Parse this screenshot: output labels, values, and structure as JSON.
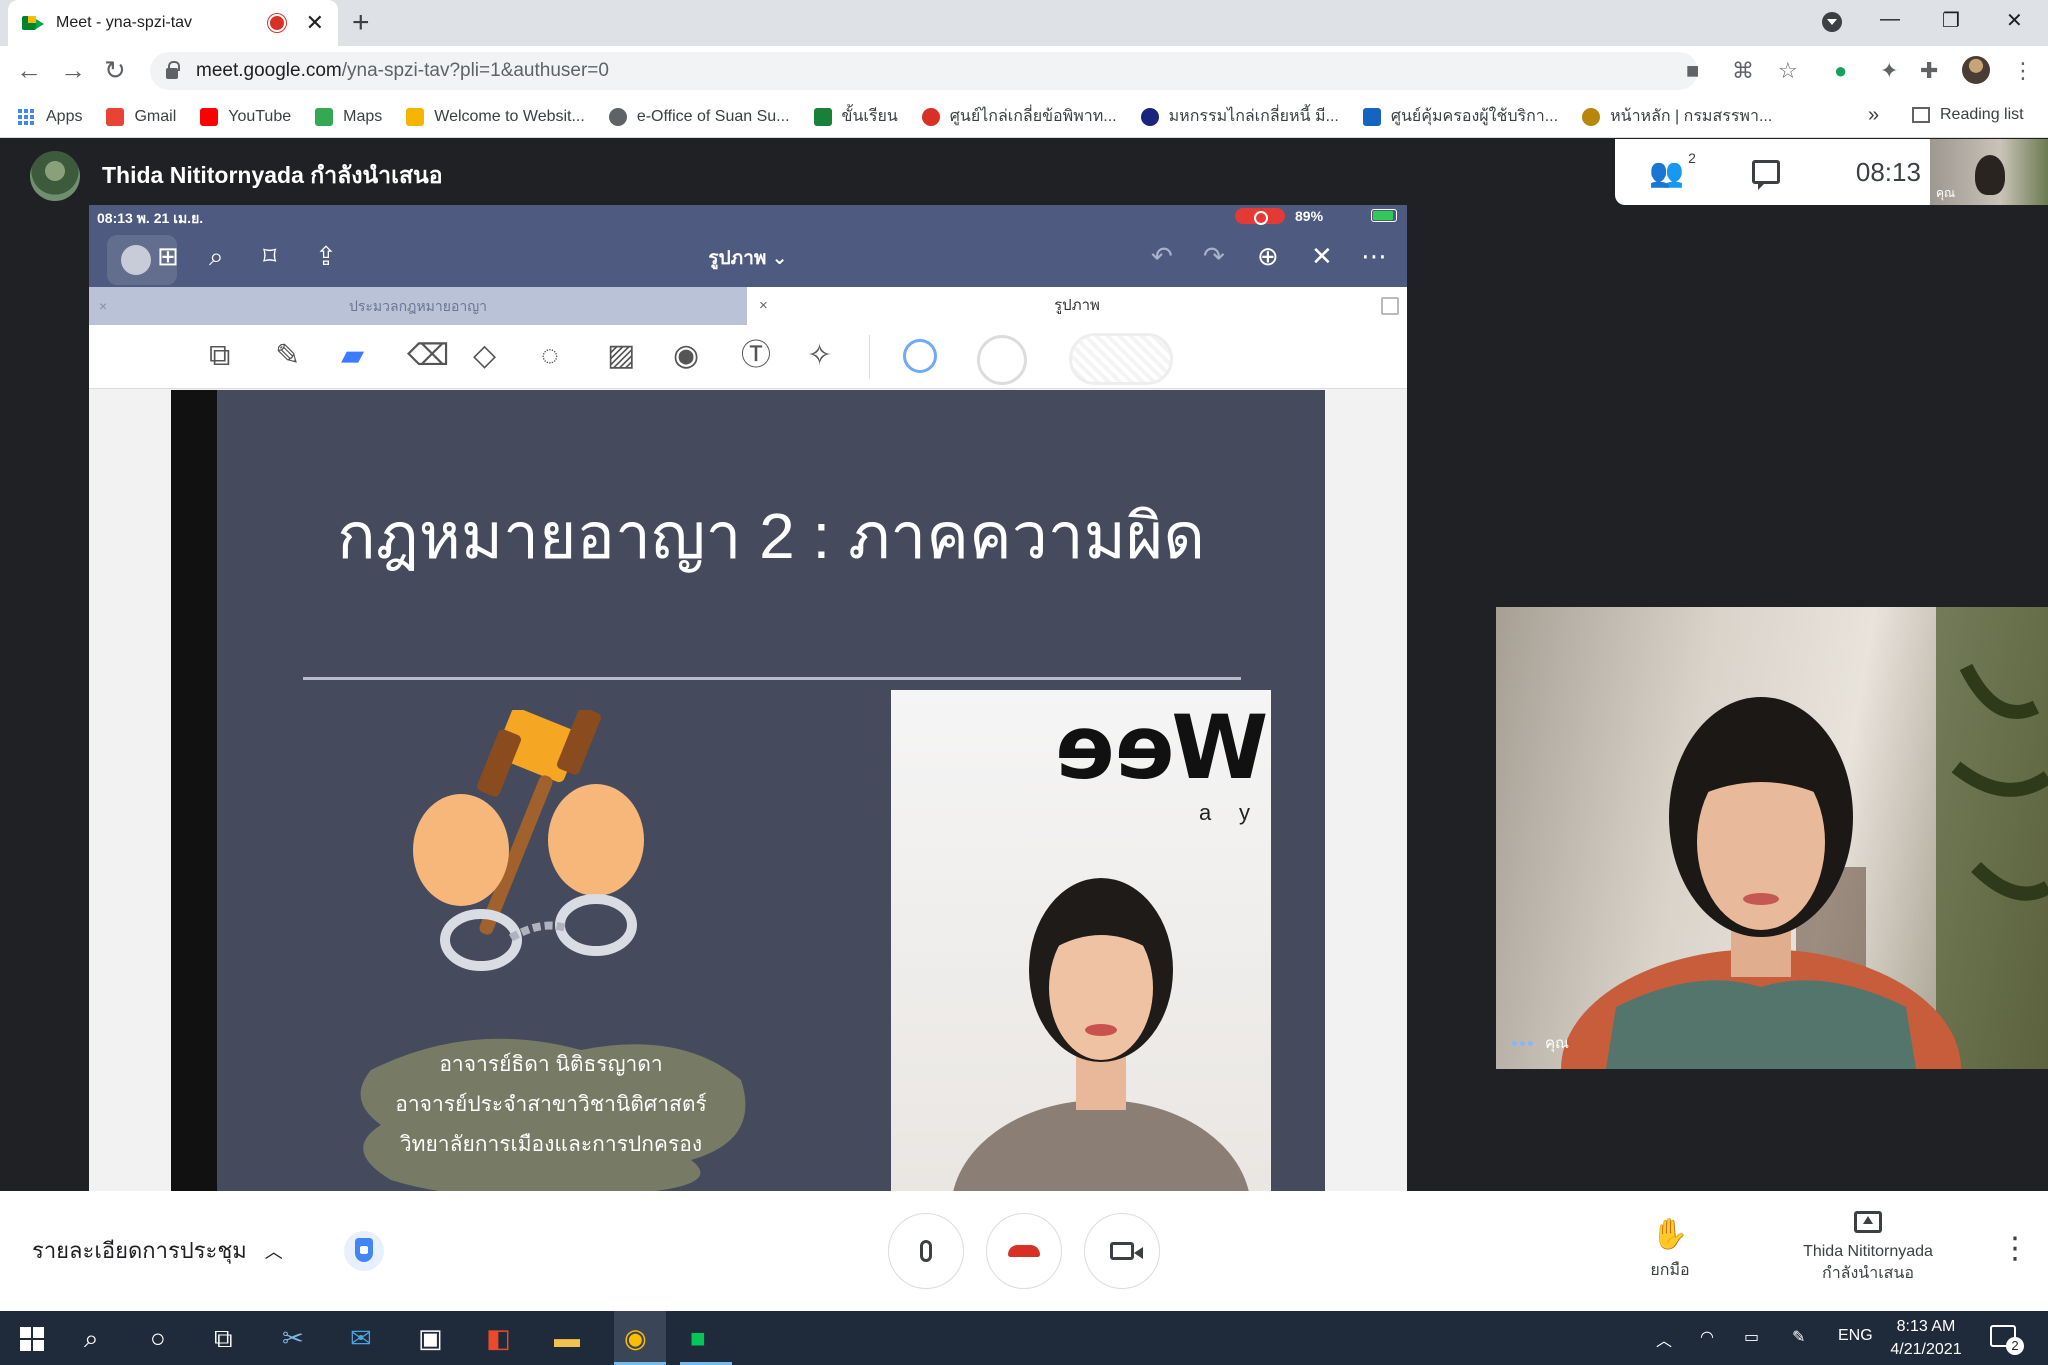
{
  "browser": {
    "tab_title": "Meet - yna-spzi-tav",
    "tab_close": "✕",
    "new_tab": "+",
    "url_host": "meet.google.com",
    "url_path": "/yna-spzi-tav?pli=1&authuser=0",
    "window_controls": [
      "—",
      "❐",
      "✕"
    ],
    "nav": [
      "←",
      "→",
      "↻"
    ],
    "bookmarks": [
      {
        "label": "Apps",
        "icon": "apps-grid-icon",
        "color": "#4285f4"
      },
      {
        "label": "Gmail",
        "icon": "gmail-icon",
        "color": "#ea4335"
      },
      {
        "label": "YouTube",
        "icon": "youtube-icon",
        "color": "#ff0000"
      },
      {
        "label": "Maps",
        "icon": "maps-icon",
        "color": "#34a853"
      },
      {
        "label": "Welcome to Websit...",
        "icon": "website-icon",
        "color": "#f4b400"
      },
      {
        "label": "e-Office of Suan Su...",
        "icon": "globe-icon",
        "color": "#5f6368"
      },
      {
        "label": "ขั้นเรียน",
        "icon": "classroom-icon",
        "color": "#188038"
      },
      {
        "label": "ศูนย์ไกล่เกลี่ยข้อพิพาท...",
        "icon": "mediation-icon",
        "color": "#d93025"
      },
      {
        "label": "มหกรรมไกล่เกลี่ยหนี้ มี...",
        "icon": "debt-icon",
        "color": "#1a237e"
      },
      {
        "label": "ศูนย์คุ้มครองผู้ใช้บริกา...",
        "icon": "consumer-icon",
        "color": "#1565c0"
      },
      {
        "label": "หน้าหลัก | กรมสรรพา...",
        "icon": "revenue-icon",
        "color": "#b8860b"
      }
    ],
    "bookmarks_more": "»",
    "reading_list": "Reading list"
  },
  "meet": {
    "presenter_banner": "Thida Nititornyada กำลังนำเสนอ",
    "participants_count": "2",
    "clock": "08:13",
    "self_label": "คุณ",
    "tile_label": "คุณ"
  },
  "ipad": {
    "status_left": "08:13  พ. 21 เม.ย.",
    "status_right": "89%",
    "doc_title": "รูปภาพ ⌄",
    "tab_1": "ประมวลกฎหมายอาญา",
    "tab_2": "รูปภาพ",
    "tab_close": "×"
  },
  "slide": {
    "title": "กฎหมายอาญา 2 : ภาคความผิด",
    "caption_1": "อาจารย์ธิดา นิติธรญาดา",
    "caption_2": "อาจารย์ประจำสาขาวิชานิติศาสตร์",
    "caption_3": "วิทยาลัยการเมืองและการปกครอง",
    "photo_brand": "Wee",
    "photo_small_1": "a",
    "photo_small_2": "y"
  },
  "controls": {
    "meeting_details": "รายละเอียดการประชุม",
    "raise_hand": "ยกมือ",
    "presenting_name": "Thida Nititornyada",
    "presenting_status": "กำลังนำเสนอ",
    "more": "⋮"
  },
  "taskbar": {
    "lang": "ENG",
    "time": "8:13 AM",
    "date": "4/21/2021",
    "notifications": "2"
  }
}
